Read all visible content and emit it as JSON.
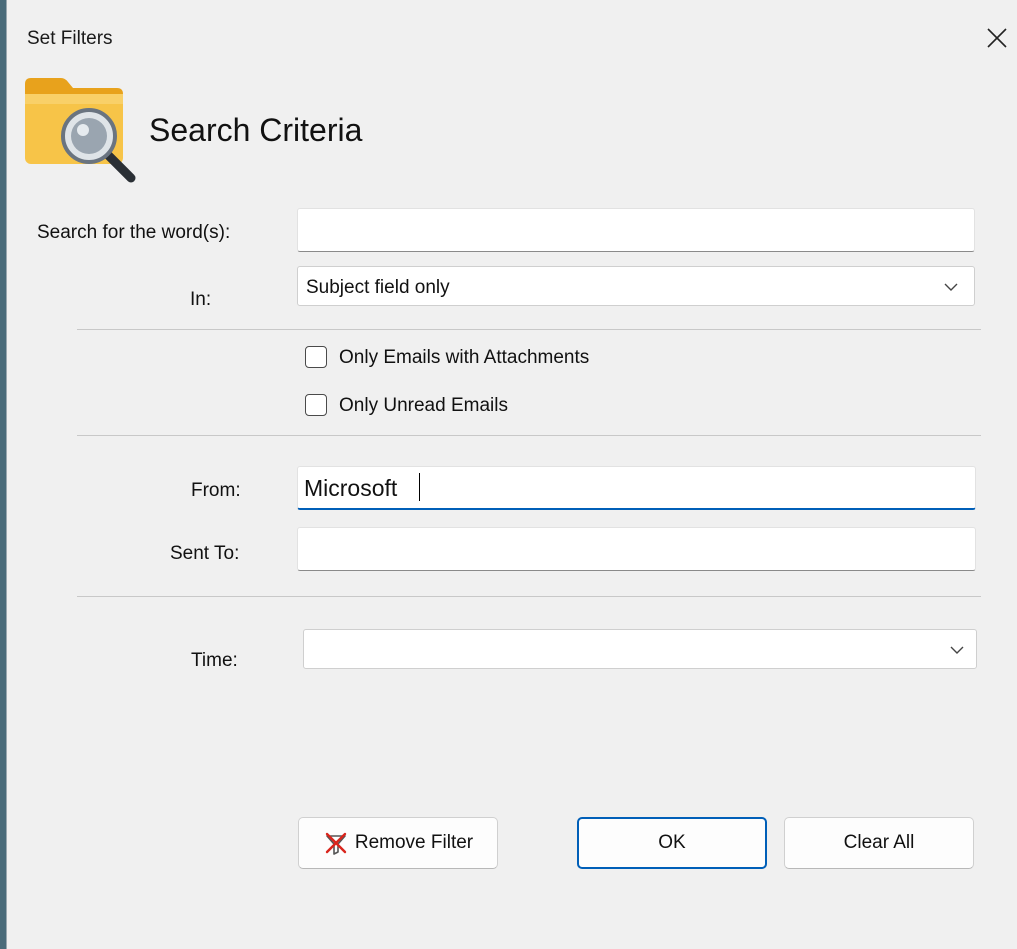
{
  "window": {
    "title": "Set Filters"
  },
  "header": {
    "title": "Search Criteria",
    "icon": "folder-search-icon"
  },
  "search": {
    "label": "Search for the word(s):",
    "value": ""
  },
  "in_field": {
    "label": "In:",
    "selected": "Subject field only"
  },
  "options": {
    "attachments": {
      "label": "Only Emails with Attachments",
      "checked": false
    },
    "unread": {
      "label": "Only Unread Emails",
      "checked": false
    }
  },
  "from": {
    "label": "From:",
    "value": "Microsoft"
  },
  "sent_to": {
    "label": "Sent To:",
    "value": ""
  },
  "time": {
    "label": "Time:",
    "selected": ""
  },
  "buttons": {
    "remove_filter": "Remove Filter",
    "ok": "OK",
    "clear_all": "Clear All"
  },
  "colors": {
    "accent": "#005fb8",
    "folder": "#f5b731",
    "background": "#f0f0f0"
  }
}
